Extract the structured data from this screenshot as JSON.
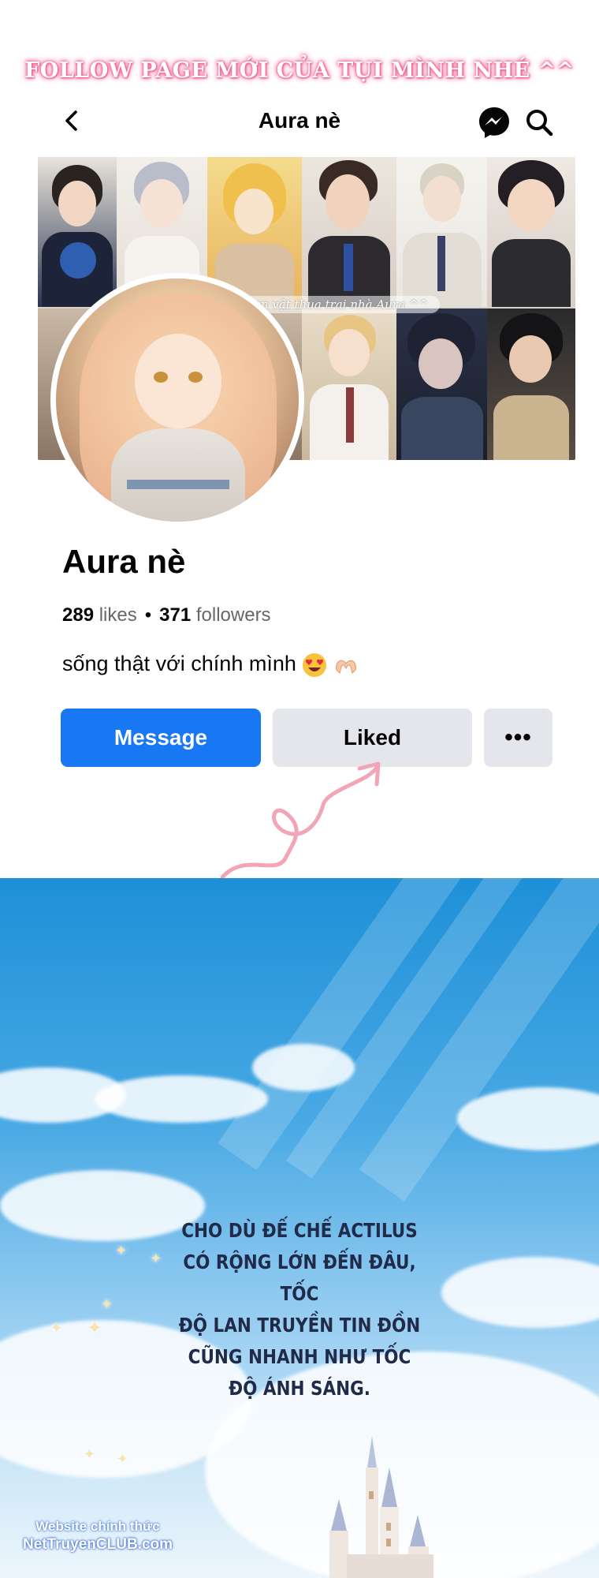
{
  "banner": {
    "text": "FOLLOW PAGE MỚI CỦA TỤI MÌNH NHÉ ^^"
  },
  "topbar": {
    "title": "Aura nè",
    "icons": {
      "back": "chevron-left-icon",
      "messenger": "messenger-icon",
      "search": "search-icon"
    }
  },
  "cover": {
    "caption": "an vật thua trai nhà Aura ^^"
  },
  "profile": {
    "name": "Aura nè",
    "likes_count": "289",
    "likes_label": "likes",
    "separator": "•",
    "followers_count": "371",
    "followers_label": "followers",
    "bio": "sống thật với chính mình",
    "bio_emojis": [
      "heart-eyes-emoji",
      "heart-hands-emoji"
    ]
  },
  "actions": {
    "message_label": "Message",
    "liked_label": "Liked",
    "more_label": "•••"
  },
  "colors": {
    "primary": "#1877f2",
    "secondary_button": "#e4e6eb",
    "muted_text": "#65676b",
    "banner_glow": "#f35b92",
    "arrow": "#f2a5b5"
  },
  "panel": {
    "speech_lines": [
      "CHO DÙ ĐẾ CHẾ ACTILUS",
      "CÓ RỘNG LỚN ĐẾN ĐÂU, TỐC",
      "ĐỘ LAN TRUYỀN TIN ĐỒN",
      "CŨNG NHANH NHƯ TỐC",
      "ĐỘ ÁNH SÁNG."
    ]
  },
  "watermark": {
    "line1": "Website chính thức",
    "line2": "NetTruyenCLUB.com"
  }
}
